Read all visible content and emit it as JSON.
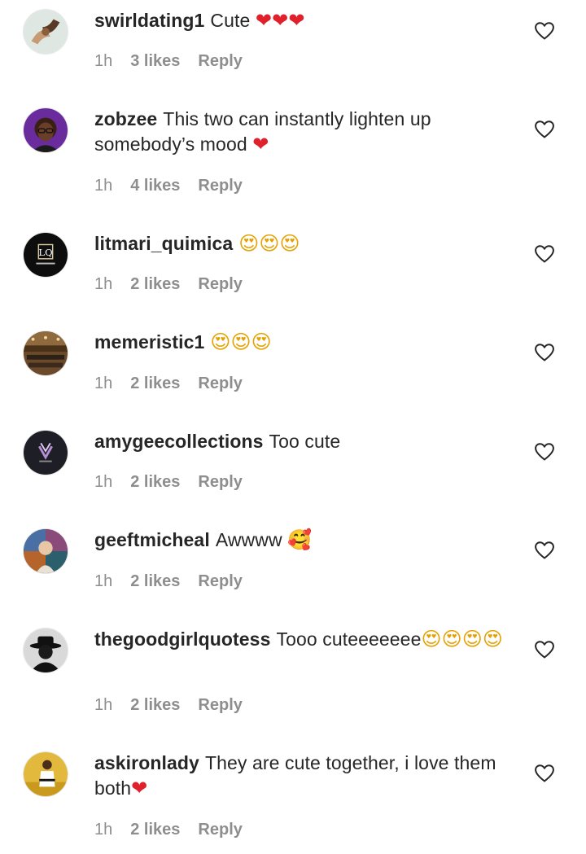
{
  "comments": [
    {
      "username": "swirldating1",
      "text": "Cute ",
      "emojis": [
        "❤",
        "❤",
        "❤"
      ],
      "emoji_kind": "heart",
      "time": "1h",
      "likes": "3 likes",
      "reply": "Reply",
      "avatar_icon": "holding-hands-avatar",
      "like_icon": "heart-outline-icon"
    },
    {
      "username": "zobzee",
      "text": "This two can instantly lighten up somebody’s mood ",
      "emojis": [
        "❤"
      ],
      "emoji_kind": "heart",
      "time": "1h",
      "likes": "4 likes",
      "reply": "Reply",
      "avatar_icon": "woman-glasses-avatar",
      "like_icon": "heart-outline-icon"
    },
    {
      "username": "litmari_quimica",
      "text": "",
      "emojis": [
        "😍",
        "😍",
        "😍"
      ],
      "emoji_kind": "face",
      "time": "1h",
      "likes": "2 likes",
      "reply": "Reply",
      "avatar_icon": "lq-logo-avatar",
      "avatar_text": "LQ",
      "like_icon": "heart-outline-icon"
    },
    {
      "username": "memeristic1",
      "text": "",
      "emojis": [
        "😍",
        "😍",
        "😍"
      ],
      "emoji_kind": "face",
      "time": "1h",
      "likes": "2 likes",
      "reply": "Reply",
      "avatar_icon": "hall-avatar",
      "like_icon": "heart-outline-icon"
    },
    {
      "username": "amygeecollections",
      "text": "Too cute",
      "emojis": [],
      "emoji_kind": "none",
      "time": "1h",
      "likes": "2 likes",
      "reply": "Reply",
      "avatar_icon": "logo-dark-avatar",
      "like_icon": "heart-outline-icon"
    },
    {
      "username": "geeftmicheal",
      "text": "Awwww ",
      "emojis": [
        "🥰"
      ],
      "emoji_kind": "face",
      "time": "1h",
      "likes": "2 likes",
      "reply": "Reply",
      "avatar_icon": "collage-avatar",
      "like_icon": "heart-outline-icon"
    },
    {
      "username": "thegoodgirlquotess",
      "text": "Tooo cuteeeeeee",
      "emojis": [
        "😍",
        "😍",
        "😍",
        "😍"
      ],
      "emoji_kind": "face",
      "time": "1h",
      "likes": "2 likes",
      "reply": "Reply",
      "avatar_icon": "silhouette-hat-avatar",
      "like_icon": "heart-outline-icon"
    },
    {
      "username": "askironlady",
      "text": "They are cute together, i love them both",
      "emojis": [
        "❤"
      ],
      "emoji_kind": "heart",
      "time": "1h",
      "likes": "2 likes",
      "reply": "Reply",
      "avatar_icon": "karate-avatar",
      "like_icon": "heart-outline-icon"
    }
  ],
  "colors": {
    "text": "#262626",
    "meta": "#8e8e8e",
    "heart_emoji": "#e0202b",
    "background": "#ffffff"
  }
}
